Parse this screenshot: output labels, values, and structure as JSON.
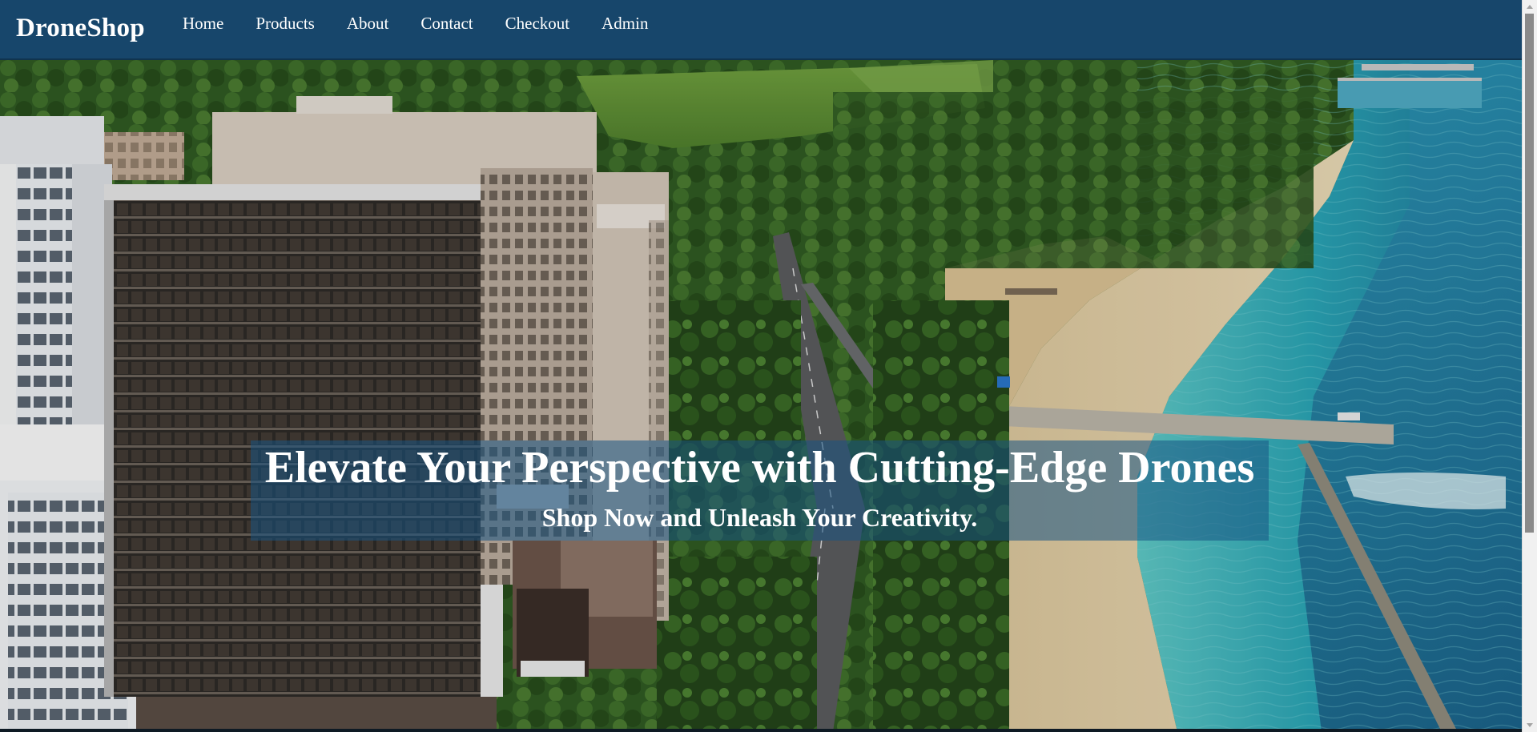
{
  "navbar": {
    "brand": "DroneShop",
    "links": [
      {
        "label": "Home"
      },
      {
        "label": "Products"
      },
      {
        "label": "About"
      },
      {
        "label": "Contact"
      },
      {
        "label": "Checkout"
      },
      {
        "label": "Admin"
      }
    ],
    "background_color": "#17466b"
  },
  "hero": {
    "title": "Elevate Your Perspective with Cutting-Edge Drones",
    "subtitle": "Shop Now and Unleash Your Creativity.",
    "banner_color": "#175484",
    "background_image": "aerial-beach-city-photo"
  }
}
